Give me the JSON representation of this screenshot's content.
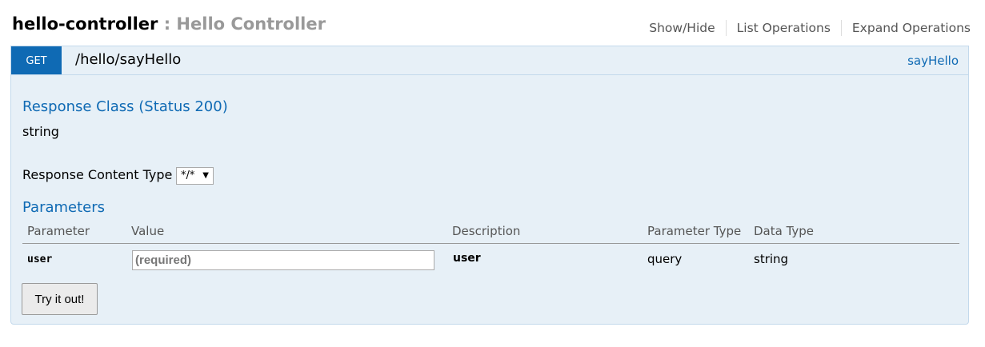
{
  "resource": {
    "name": "hello-controller",
    "separator": " : ",
    "description": "Hello Controller",
    "ops": [
      "Show/Hide",
      "List Operations",
      "Expand Operations"
    ]
  },
  "operation": {
    "method": "GET",
    "path": "/hello/sayHello",
    "nickname": "sayHello",
    "response_class_title": "Response Class (Status 200)",
    "response_class_value": "string",
    "content_type_label": "Response Content Type",
    "content_type_selected": "*/*",
    "parameters_title": "Parameters",
    "columns": [
      "Parameter",
      "Value",
      "Description",
      "Parameter Type",
      "Data Type"
    ],
    "params": [
      {
        "name": "user",
        "placeholder": "(required)",
        "description": "user",
        "param_type": "query",
        "data_type": "string"
      }
    ],
    "try_label": "Try it out!"
  }
}
